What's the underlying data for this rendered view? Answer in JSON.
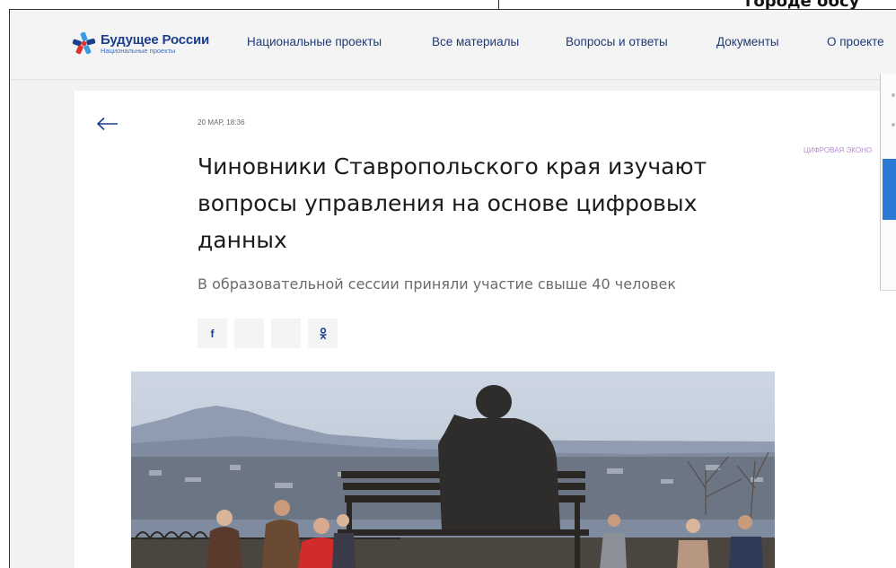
{
  "background_strip": {
    "cut_text": "городе обсу"
  },
  "header": {
    "logo": {
      "title": "Будущее России",
      "subtitle": "Национальные проекты"
    },
    "nav": [
      {
        "label": "Национальные проекты"
      },
      {
        "label": "Все материалы"
      },
      {
        "label": "Вопросы и ответы"
      },
      {
        "label": "Документы"
      },
      {
        "label": "О проекте"
      }
    ]
  },
  "article": {
    "date": "20 МАР, 18:36",
    "tag": "ЦИФРОВАЯ ЭКОНО",
    "title": "Чиновники Ставропольского края изучают вопросы управления на основе цифровых данных",
    "subtitle": "В образовательной сессии приняли участие свыше 40 человек",
    "share_buttons": [
      {
        "icon": "facebook-icon",
        "glyph": "f"
      },
      {
        "icon": "vk-icon",
        "glyph": ""
      },
      {
        "icon": "twitter-icon",
        "glyph": ""
      },
      {
        "icon": "odnoklassniki-icon",
        "glyph": "ok"
      }
    ],
    "photo": {
      "description_icon": "article-photo"
    }
  },
  "colors": {
    "brand_blue": "#1b3f8e",
    "nav_text": "#1f3b73",
    "tag_purple": "#b889d6",
    "logo_red": "#e0322b",
    "logo_light_blue": "#3b9be0",
    "overlay_blue": "#2a7ad6"
  }
}
